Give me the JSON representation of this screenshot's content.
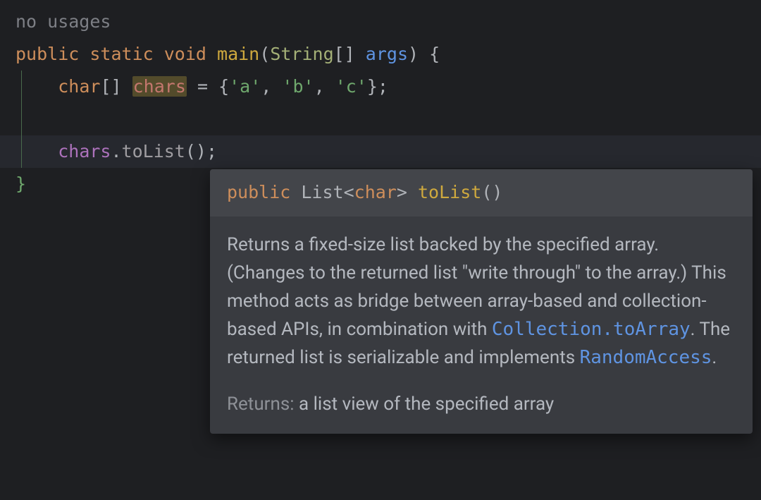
{
  "code": {
    "usages_hint": "no usages",
    "kw_public": "public",
    "kw_static": "static",
    "kw_void": "void",
    "kw_char": "char",
    "fn_main": "main",
    "type_string": "String",
    "param_args": "args",
    "local_chars": "chars",
    "chr_a": "'a'",
    "chr_b": "'b'",
    "chr_c": "'c'",
    "field_chars": "chars",
    "call_tolist": "toList"
  },
  "tooltip": {
    "sig": {
      "kw_public": "public",
      "type_list": "List",
      "gen_char": "char",
      "name": "toList"
    },
    "doc_part1": "Returns a fixed-size list backed by the specified array. (Changes to the returned list \"write through\" to the array.) This method acts as bridge between array-based and collection-based APIs, in combination with ",
    "doc_link1": "Collection.toArray",
    "doc_part2": ". The returned list is serializable and implements ",
    "doc_link2": "RandomAccess",
    "doc_part3": ".",
    "returns_tag": "Returns:",
    "returns_text": " a list view of the specified array"
  }
}
